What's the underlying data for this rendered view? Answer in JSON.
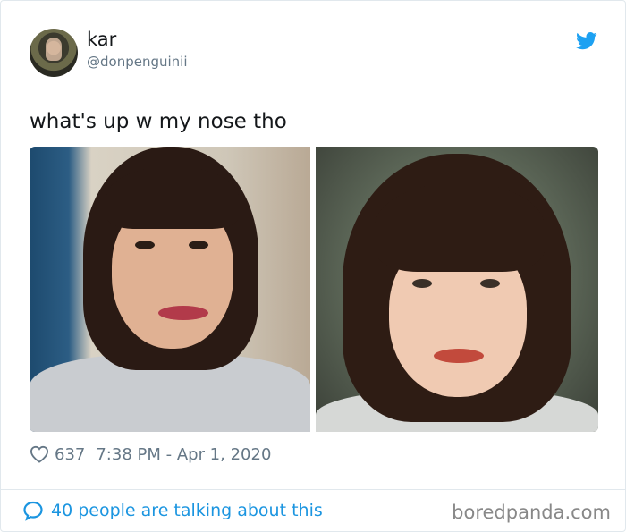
{
  "tweet": {
    "author_name": "kar",
    "author_handle": "@donpenguinii",
    "text": "what's up w my nose tho",
    "like_count": "637",
    "timestamp": "7:38 PM - Apr 1, 2020",
    "conversation_text": "40 people are talking about this",
    "icons": {
      "platform": "twitter-bird-icon",
      "like": "heart-icon",
      "reply": "speech-bubble-icon"
    },
    "colors": {
      "accent": "#1da1f2",
      "link": "#1b95e0",
      "secondary_text": "#657786",
      "border": "#e1e8ed"
    }
  },
  "watermark": "boredpanda.com"
}
